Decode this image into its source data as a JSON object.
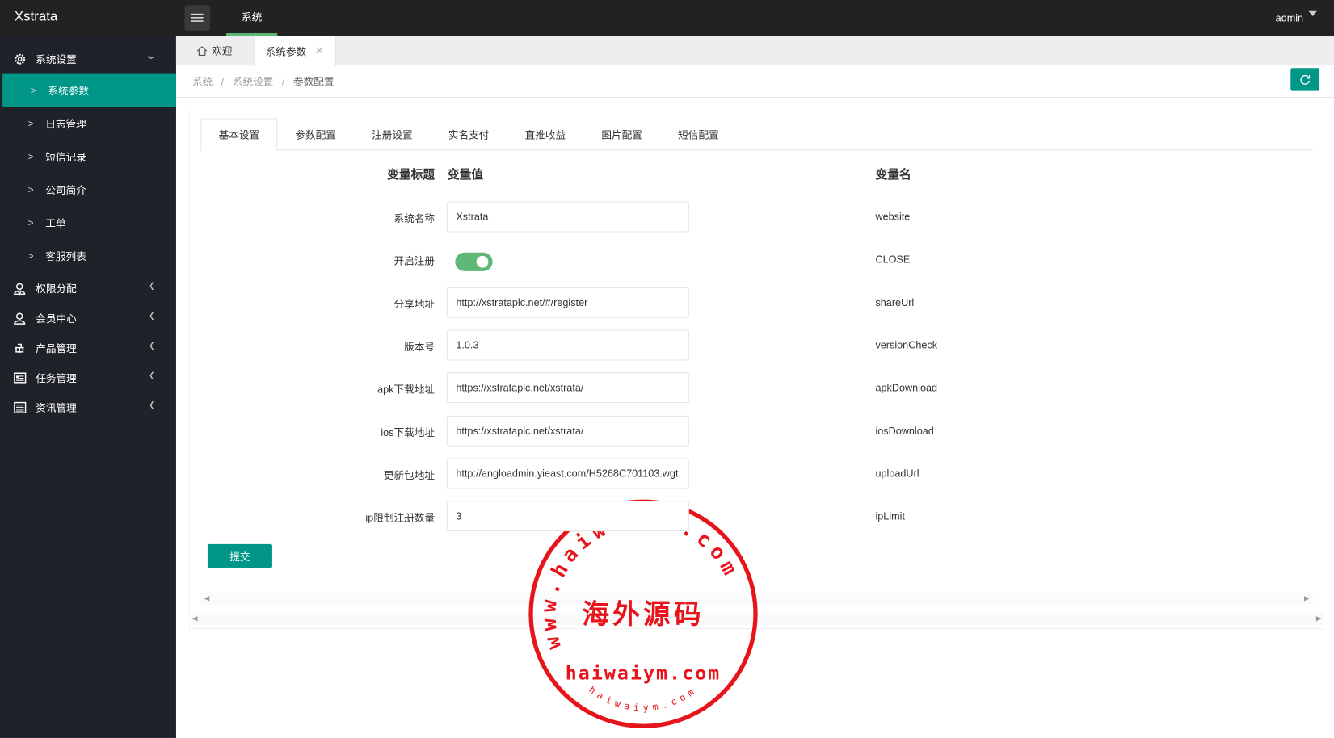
{
  "app": {
    "logo": "Xstrata",
    "nav_item": "系统",
    "user": "admin"
  },
  "sidebar": {
    "section": {
      "label": "系统设置",
      "icon": "gear-icon"
    },
    "sub_items": [
      {
        "label": "系统参数",
        "active": true
      },
      {
        "label": "日志管理"
      },
      {
        "label": "短信记录"
      },
      {
        "label": "公司简介"
      },
      {
        "label": "工单"
      },
      {
        "label": "客服列表"
      }
    ],
    "groups": [
      {
        "label": "权限分配",
        "icon": "user-group-icon"
      },
      {
        "label": "会员中心",
        "icon": "user-icon"
      },
      {
        "label": "产品管理",
        "icon": "product-icon"
      },
      {
        "label": "任务管理",
        "icon": "task-icon"
      },
      {
        "label": "资讯管理",
        "icon": "news-icon"
      }
    ]
  },
  "page_tabs": [
    {
      "label": "欢迎",
      "icon": "home-icon"
    },
    {
      "label": "系统参数",
      "active": true,
      "closable": true
    }
  ],
  "breadcrumb": [
    "系统",
    "系统设置",
    "参数配置"
  ],
  "inner_tabs": [
    "基本设置",
    "参数配置",
    "注册设置",
    "实名支付",
    "直推收益",
    "图片配置",
    "短信配置"
  ],
  "form": {
    "headers": {
      "title": "变量标题",
      "value": "变量值",
      "name": "变量名"
    },
    "rows": [
      {
        "label": "系统名称",
        "value": "Xstrata",
        "name": "website"
      },
      {
        "label": "开启注册",
        "toggle": true,
        "name": "CLOSE"
      },
      {
        "label": "分享地址",
        "value": "http://xstrataplc.net/#/register",
        "name": "shareUrl"
      },
      {
        "label": "版本号",
        "value": "1.0.3",
        "name": "versionCheck"
      },
      {
        "label": "apk下载地址",
        "value": "https://xstrataplc.net/xstrata/",
        "name": "apkDownload"
      },
      {
        "label": "ios下载地址",
        "value": "https://xstrataplc.net/xstrata/",
        "name": "iosDownload"
      },
      {
        "label": "更新包地址",
        "value": "http://angloadmin.yieast.com/H5268C701103.wgt",
        "name": "uploadUrl"
      },
      {
        "label": "ip限制注册数量",
        "value": "3",
        "name": "ipLimit"
      }
    ],
    "submit": "提交"
  },
  "watermark": {
    "ring_text": "www.haiwaiym.com",
    "center": "海外源码",
    "domain": "haiwaiym.com",
    "bottom": "haiwaiym.com"
  },
  "colors": {
    "accent": "#009688",
    "toggle": "#5FB878",
    "topbar": "#222222",
    "sidebar": "#20222A",
    "stamp": "#E8141B"
  }
}
